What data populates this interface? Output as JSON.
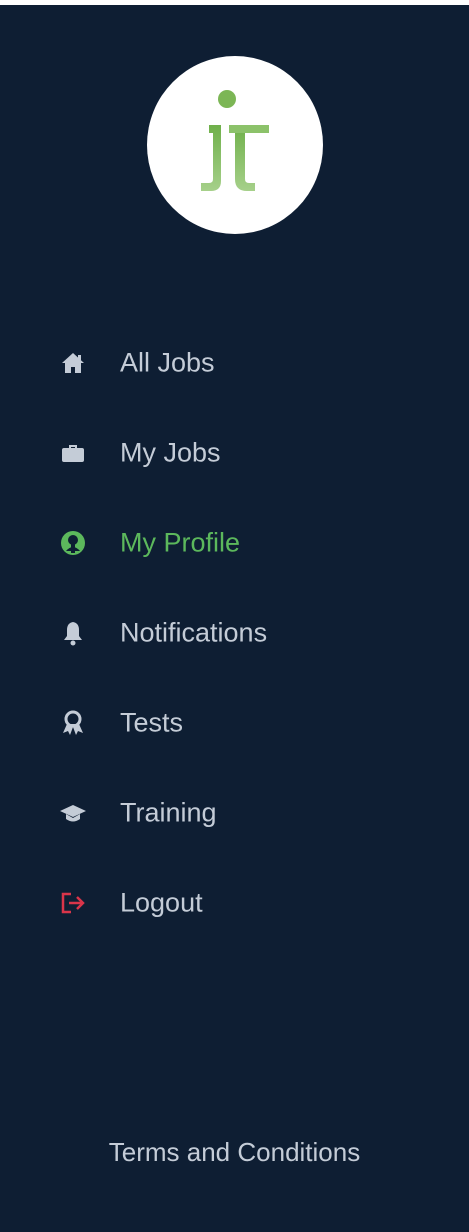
{
  "logo": {
    "icon": "jt-logo",
    "color": "#7cb655"
  },
  "nav": {
    "items": [
      {
        "label": "All Jobs",
        "icon": "home-icon",
        "active": false
      },
      {
        "label": "My Jobs",
        "icon": "briefcase-icon",
        "active": false
      },
      {
        "label": "My Profile",
        "icon": "user-circle-icon",
        "active": true
      },
      {
        "label": "Notifications",
        "icon": "bell-icon",
        "active": false
      },
      {
        "label": "Tests",
        "icon": "award-icon",
        "active": false
      },
      {
        "label": "Training",
        "icon": "graduation-cap-icon",
        "active": false
      },
      {
        "label": "Logout",
        "icon": "logout-icon",
        "active": false
      }
    ]
  },
  "footer": {
    "terms_label": "Terms and Conditions"
  },
  "colors": {
    "sidebar_bg": "#0e1e33",
    "text": "#c4ccd7",
    "active": "#5cb85c",
    "logout": "#d9354a"
  }
}
